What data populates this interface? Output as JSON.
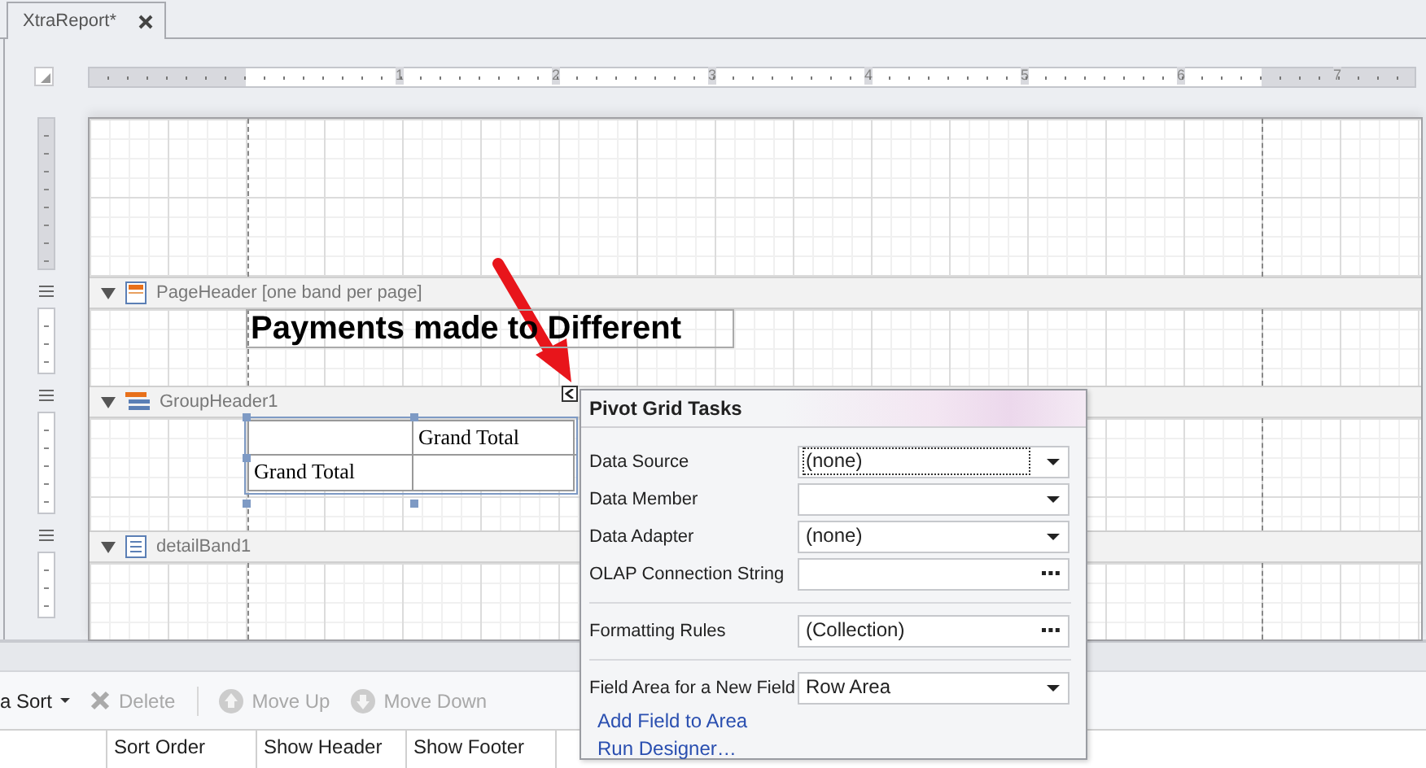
{
  "tab": {
    "title": "XtraReport*"
  },
  "ruler": {
    "labels": [
      "1",
      "2",
      "3",
      "4",
      "5",
      "6",
      "7"
    ]
  },
  "bands": [
    {
      "name": "PageHeader [one band per page]",
      "kind": "page-header",
      "expanded": true
    },
    {
      "name": "GroupHeader1",
      "kind": "group-header",
      "expanded": true
    },
    {
      "name": "detailBand1",
      "kind": "detail",
      "expanded": true
    }
  ],
  "title_label": "Payments made to Different",
  "pivot_table": {
    "column_header": "Grand Total",
    "row_header": "Grand Total"
  },
  "tasks_panel": {
    "title": "Pivot Grid Tasks",
    "groups": [
      [
        {
          "label": "Data Source",
          "value": "(none)",
          "kind": "dropdown",
          "focused": true
        },
        {
          "label": "Data Member",
          "kind": "dropdown",
          "focused": false
        },
        {
          "label": "Data Adapter",
          "value": "(none)",
          "kind": "dropdown",
          "focused": false
        },
        {
          "label": "OLAP Connection String",
          "kind": "ellipsis",
          "focused": false
        }
      ],
      [
        {
          "label": "Formatting Rules",
          "value": "(Collection)",
          "kind": "ellipsis",
          "focused": false
        }
      ],
      [
        {
          "label": "Field Area for a New Field",
          "value": "Row Area",
          "kind": "dropdown",
          "focused": false
        }
      ]
    ],
    "links": [
      "Add Field to Area",
      "Run Designer…"
    ]
  },
  "toolbar": [
    {
      "label": "a Sort",
      "kind": "dropdown",
      "disabled": false
    },
    {
      "label": "Delete",
      "kind": "delete",
      "disabled": true
    },
    {
      "label": "Move Up",
      "kind": "up",
      "disabled": true
    },
    {
      "label": "Move Down",
      "kind": "down",
      "disabled": true
    }
  ],
  "columns": [
    "Sort Order",
    "Show Header",
    "Show Footer"
  ]
}
